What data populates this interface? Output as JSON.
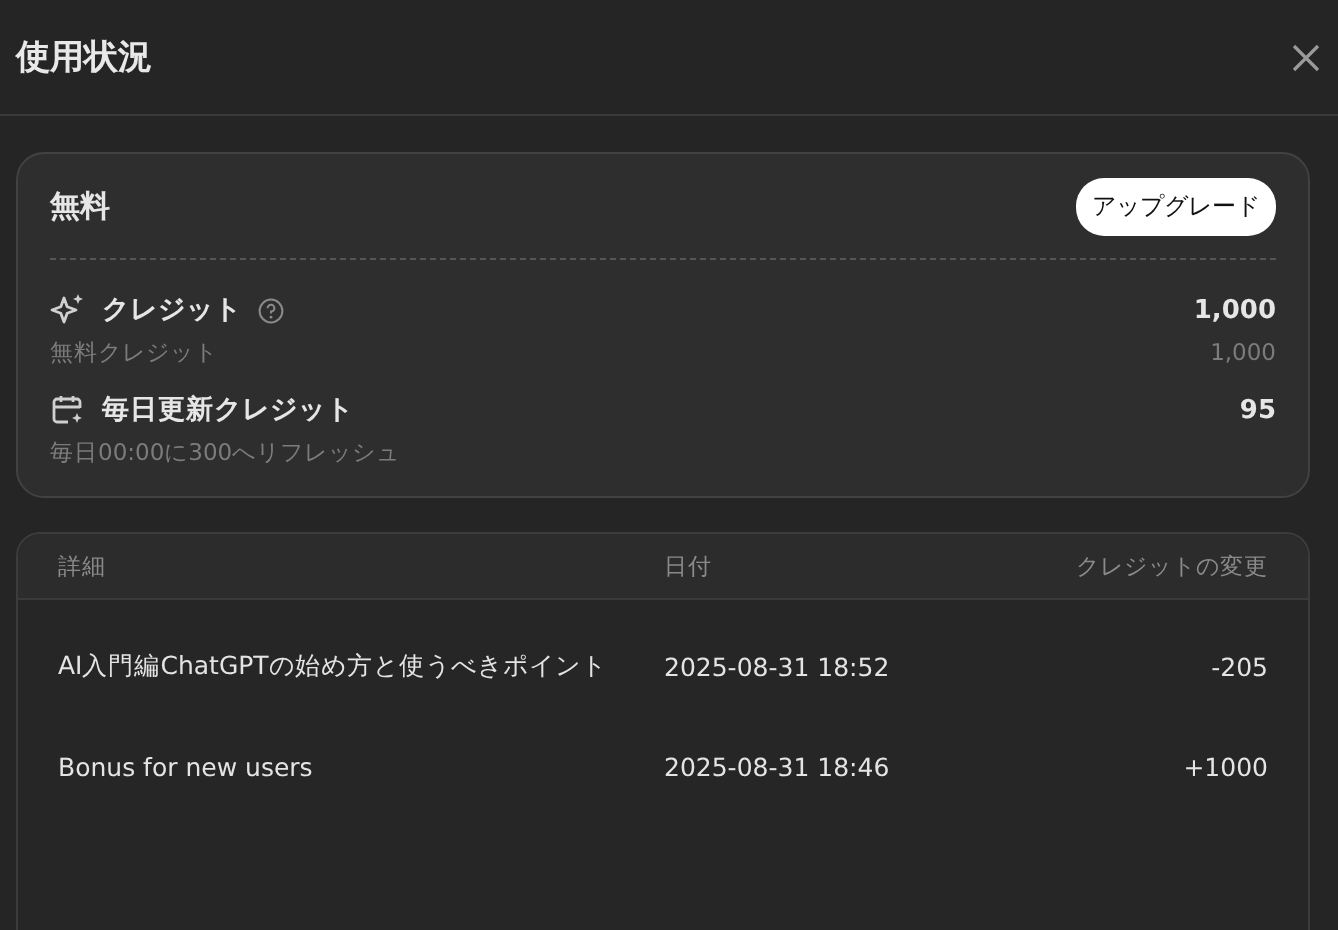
{
  "dialog": {
    "title": "使用状況"
  },
  "plan": {
    "name": "無料",
    "upgrade_button": "アップグレード"
  },
  "credits": [
    {
      "kind": "sparkle",
      "label": "クレジット",
      "help": true,
      "value": "1,000",
      "sub_label": "無料クレジット",
      "sub_value": "1,000"
    },
    {
      "kind": "calendar",
      "label": "毎日更新クレジット",
      "help": false,
      "value": "95",
      "sub_label": "毎日00:00に300へリフレッシュ"
    }
  ],
  "table": {
    "columns": [
      "詳細",
      "日付",
      "クレジットの変更"
    ],
    "rows": [
      {
        "detail": "AI入門編ChatGPTの始め方と使うべきポイント",
        "date": "2025-08-31 18:52",
        "change": "-205"
      },
      {
        "detail": "Bonus for new users",
        "date": "2025-08-31 18:46",
        "change": "+1000"
      }
    ]
  }
}
